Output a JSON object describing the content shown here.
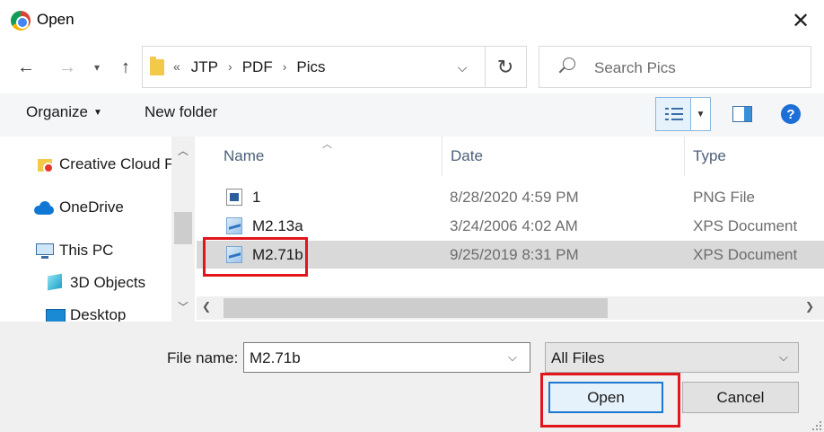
{
  "window": {
    "title": "Open"
  },
  "nav": {
    "back_label": "←",
    "forward_label": "→",
    "recent_label": "▾",
    "up_label": "↑",
    "breadcrumb_prefix": "«",
    "breadcrumb": [
      "JTP",
      "PDF",
      "Pics"
    ],
    "breadcrumb_sep": "›",
    "search_placeholder": "Search Pics"
  },
  "toolbar": {
    "organize_label": "Organize",
    "new_folder_label": "New folder",
    "help_label": "?"
  },
  "navpane": {
    "items": [
      {
        "label": "Creative Cloud F",
        "icon": "creative-cloud-folder-icon"
      },
      {
        "label": "OneDrive",
        "icon": "onedrive-icon"
      },
      {
        "label": "This PC",
        "icon": "this-pc-icon"
      },
      {
        "label": "3D Objects",
        "icon": "3d-objects-icon"
      },
      {
        "label": "Desktop",
        "icon": "desktop-icon"
      }
    ]
  },
  "filelist": {
    "columns": [
      "Name",
      "Date",
      "Type"
    ],
    "rows": [
      {
        "name": "1",
        "date": "8/28/2020 4:59 PM",
        "type": "PNG File",
        "icon": "png-file-icon",
        "selected": false
      },
      {
        "name": "M2.13a",
        "date": "3/24/2006 4:02 AM",
        "type": "XPS Document",
        "icon": "xps-document-icon",
        "selected": false
      },
      {
        "name": "M2.71b",
        "date": "9/25/2019 8:31 PM",
        "type": "XPS Document",
        "icon": "xps-document-icon",
        "selected": true
      }
    ]
  },
  "footer": {
    "file_name_label": "File name:",
    "file_name_value": "M2.71b",
    "file_type_value": "All Files",
    "open_label": "Open",
    "cancel_label": "Cancel"
  },
  "colors": {
    "highlight_red": "#e2151c",
    "selection": "#d9d9d9",
    "accent_blue": "#1b78d0"
  }
}
